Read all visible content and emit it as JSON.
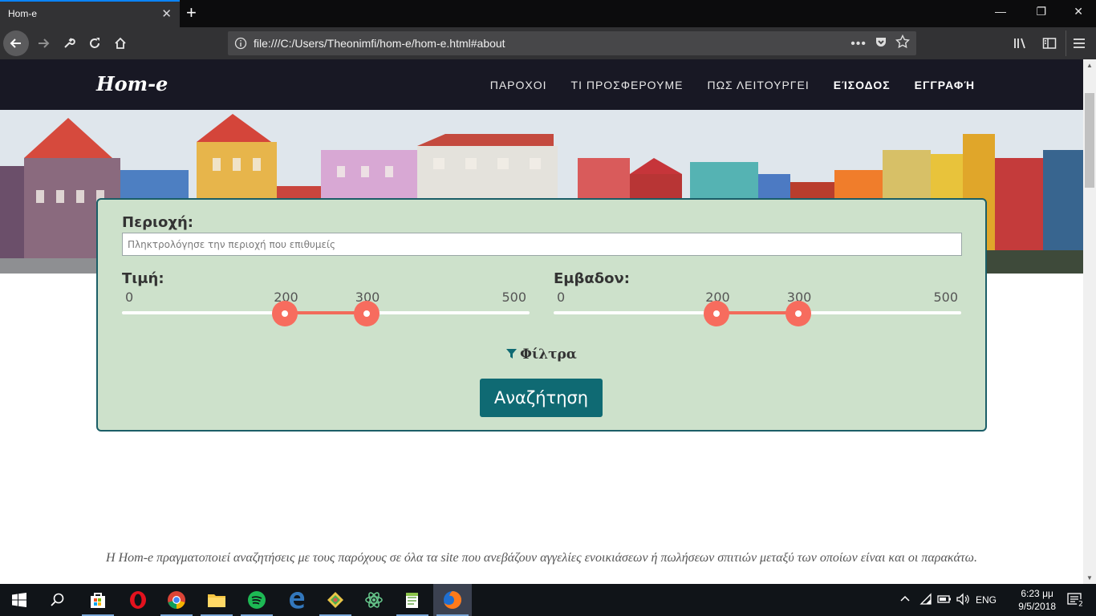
{
  "browser": {
    "tab_title": "Hom-e",
    "url": "file:///C:/Users/Theonimfi/hom-e/hom-e.html#about"
  },
  "site": {
    "logo": "Hom-e",
    "menu": [
      {
        "label": "ΠΑΡΟΧΟΙ",
        "bold": false
      },
      {
        "label": "ΤΙ ΠΡΟΣΦΕΡΟΥΜΕ",
        "bold": false
      },
      {
        "label": "ΠΩΣ ΛΕΙΤΟΥΡΓΕΙ",
        "bold": false
      },
      {
        "label": "ΕΊΣΟΔΟΣ",
        "bold": true
      },
      {
        "label": "ΕΓΓΡΑΦΉ",
        "bold": true
      }
    ]
  },
  "search": {
    "area_label": "Περιοχή:",
    "area_placeholder": "Πληκτρολόγησε την περιοχή που επιθυμείς",
    "price": {
      "label": "Τιμή:",
      "min": 0,
      "max": 500,
      "from": 200,
      "to": 300,
      "tick_min": "0",
      "tick_max": "500",
      "tick_from": "200",
      "tick_to": "300"
    },
    "size": {
      "label": "Εμβαδον:",
      "min": 0,
      "max": 500,
      "from": 200,
      "to": 300,
      "tick_min": "0",
      "tick_max": "500",
      "tick_from": "200",
      "tick_to": "300"
    },
    "filters_label": "Φίλτρα",
    "button_label": "Αναζήτηση"
  },
  "about_text": "Η Hom-e πραγματοποιεί αναζητήσεις με τους παρόχους σε όλα τα site που ανεβάζουν αγγελίες ενοικιάσεων ή πωλήσεων σπιτιών μεταξύ των οποίων είναι και οι παρακάτω.",
  "taskbar": {
    "language": "ENG",
    "time": "6:23 μμ",
    "date": "9/5/2018",
    "notifications": "2"
  },
  "colors": {
    "nav_bg": "#181824",
    "panel_bg": "#cde1cb",
    "panel_border": "#1b5e67",
    "slider_accent": "#f76c5e",
    "button_bg": "#0f6a73"
  }
}
